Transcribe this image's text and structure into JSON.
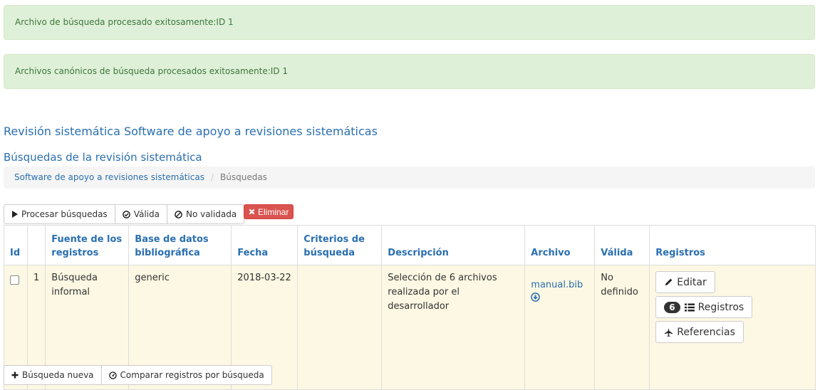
{
  "alerts": {
    "first": "Archivo de búsqueda procesado exitosamente:ID 1",
    "second": "Archivos canónicos de búsqueda procesados exitosamente:ID 1"
  },
  "page": {
    "title": "Revisión sistemática Software de apoyo a revisiones sistemáticas",
    "subtitle": "Búsquedas de la revisión sistemática"
  },
  "breadcrumb": {
    "link": "Software de apoyo a revisiones sistemáticas",
    "separator": "/",
    "active": "Búsquedas"
  },
  "toolbar": {
    "process_label": "Procesar búsquedas",
    "valid_label": "Válida",
    "not_valid_label": "No validada",
    "delete_label": "Eliminar"
  },
  "table": {
    "headers": {
      "id": "Id",
      "source": "Fuente de los registros",
      "database": "Base de datos bibliográfica",
      "date": "Fecha",
      "criteria": "Criterios de búsqueda",
      "description": "Descripción",
      "file": "Archivo",
      "valid": "Válida",
      "records": "Registros"
    },
    "rows": [
      {
        "id": "1",
        "source": "Búsqueda informal",
        "database": "generic",
        "date": "2018-03-22",
        "criteria": "",
        "description": "Selección de 6 archivos realizada por el desarrollador",
        "file": "manual.bib",
        "valid": "No definido",
        "edit_label": "Editar",
        "records_count": "6",
        "records_label": "Registros",
        "references_label": "Referencias"
      }
    ]
  },
  "bottom": {
    "new_search_label": "Búsqueda nueva",
    "compare_label": "Comparar registros por búsqueda"
  },
  "colors": {
    "alert_bg": "#dff0d8",
    "alert_text": "#3c763d",
    "link": "#2a6fb0",
    "row_bg": "#fcf8e3",
    "danger": "#d9534f"
  },
  "icons": {
    "process": "play-icon",
    "valid": "check-circle-icon",
    "not_valid": "ban-icon",
    "delete": "x-icon",
    "download": "download-circle-icon",
    "edit": "pencil-icon",
    "records": "list-icon",
    "references": "plane-icon",
    "new_search": "plus-icon",
    "compare": "dashboard-icon"
  }
}
